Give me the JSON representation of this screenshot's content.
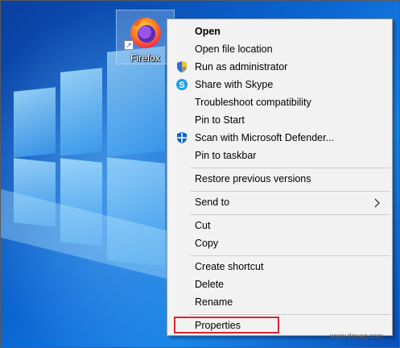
{
  "desktop": {
    "shortcut_label": "Firefox",
    "shortcut_icon": "firefox-icon",
    "wallpaper": "windows-10-hero"
  },
  "context_menu": {
    "items": [
      {
        "label": "Open",
        "bold": true
      },
      {
        "label": "Open file location"
      },
      {
        "label": "Run as administrator",
        "icon": "uac-shield-icon"
      },
      {
        "label": "Share with Skype",
        "icon": "skype-icon"
      },
      {
        "label": "Troubleshoot compatibility"
      },
      {
        "label": "Pin to Start"
      },
      {
        "label": "Scan with Microsoft Defender...",
        "icon": "defender-icon"
      },
      {
        "label": "Pin to taskbar"
      },
      {
        "label": "Restore previous versions"
      },
      {
        "label": "Send to",
        "submenu": true
      },
      {
        "label": "Cut"
      },
      {
        "label": "Copy"
      },
      {
        "label": "Create shortcut"
      },
      {
        "label": "Delete"
      },
      {
        "label": "Rename"
      },
      {
        "label": "Properties",
        "highlighted": true
      }
    ]
  },
  "watermark": "www.deuaq.com",
  "colors": {
    "menu_bg": "#f2f2f2",
    "highlight": "#d9262c",
    "accent": "#0078d7"
  }
}
